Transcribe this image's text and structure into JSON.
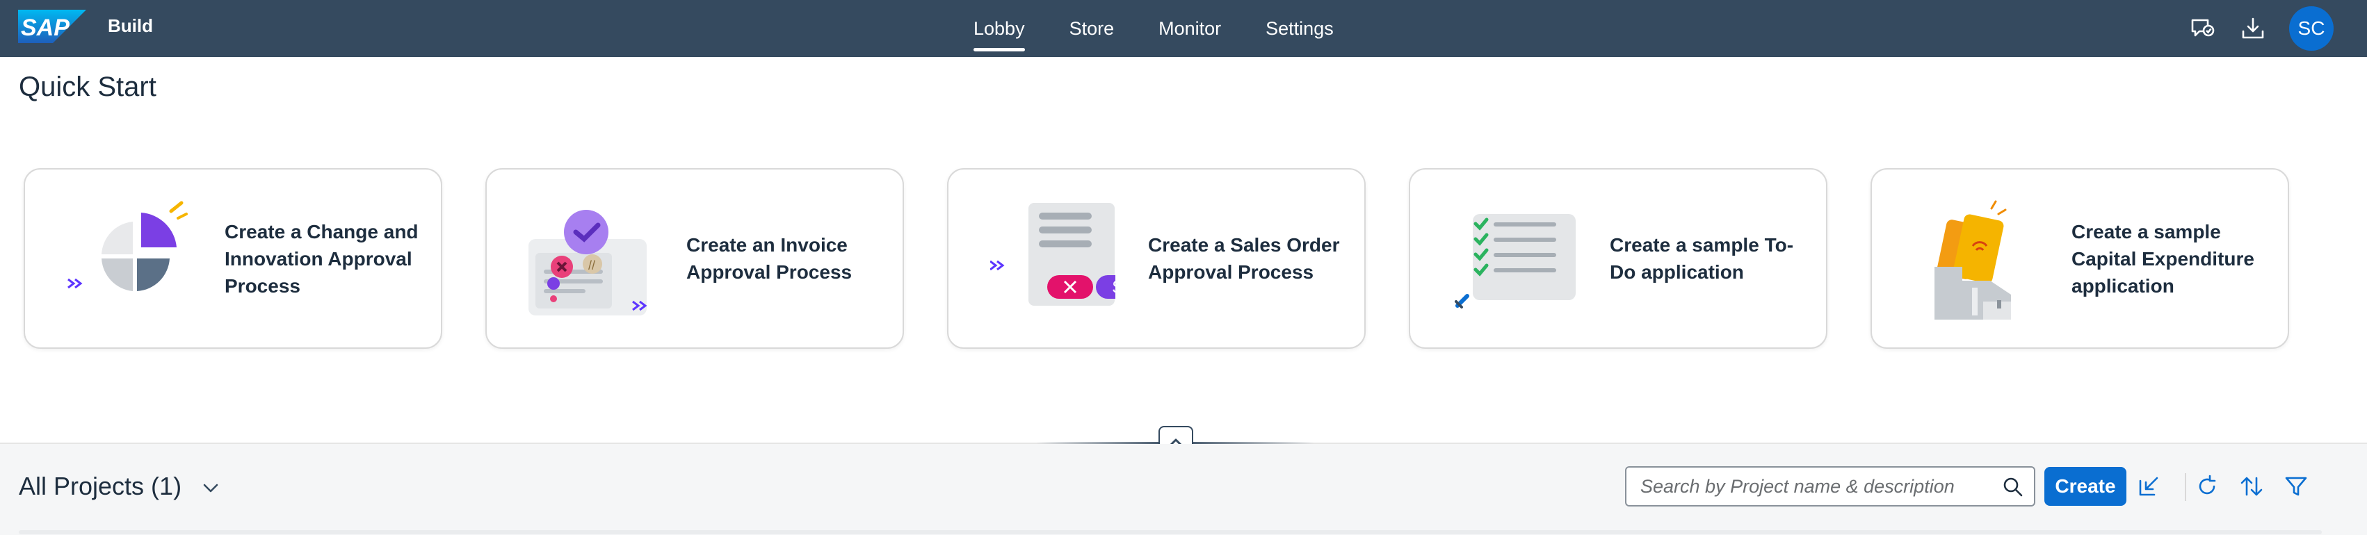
{
  "shell": {
    "logo_text": "SAP",
    "product": "Build",
    "nav": [
      {
        "label": "Lobby",
        "active": true
      },
      {
        "label": "Store",
        "active": false
      },
      {
        "label": "Monitor",
        "active": false
      },
      {
        "label": "Settings",
        "active": false
      }
    ],
    "icons": [
      "feedback-icon",
      "download-icon"
    ],
    "avatar_initials": "SC"
  },
  "quick_start": {
    "title": "Quick Start",
    "cards": [
      {
        "label": "Create a Change and Innovation Approval Process"
      },
      {
        "label": "Create an Invoice Approval Process"
      },
      {
        "label": "Create a Sales Order Approval Process"
      },
      {
        "label": "Create a sample To-Do application"
      },
      {
        "label": "Create a sample Capital Expenditure application"
      }
    ]
  },
  "projects": {
    "title": "All Projects (1)",
    "search_placeholder": "Search by Project name & description",
    "create_label": "Create",
    "toolbar_icons": [
      "import-icon",
      "refresh-icon",
      "sort-icon",
      "filter-icon"
    ]
  },
  "colors": {
    "shell_bg": "#354a5f",
    "accent": "#0a6ed1",
    "text": "#1d2d3e",
    "card_border": "#d9d9d9"
  }
}
